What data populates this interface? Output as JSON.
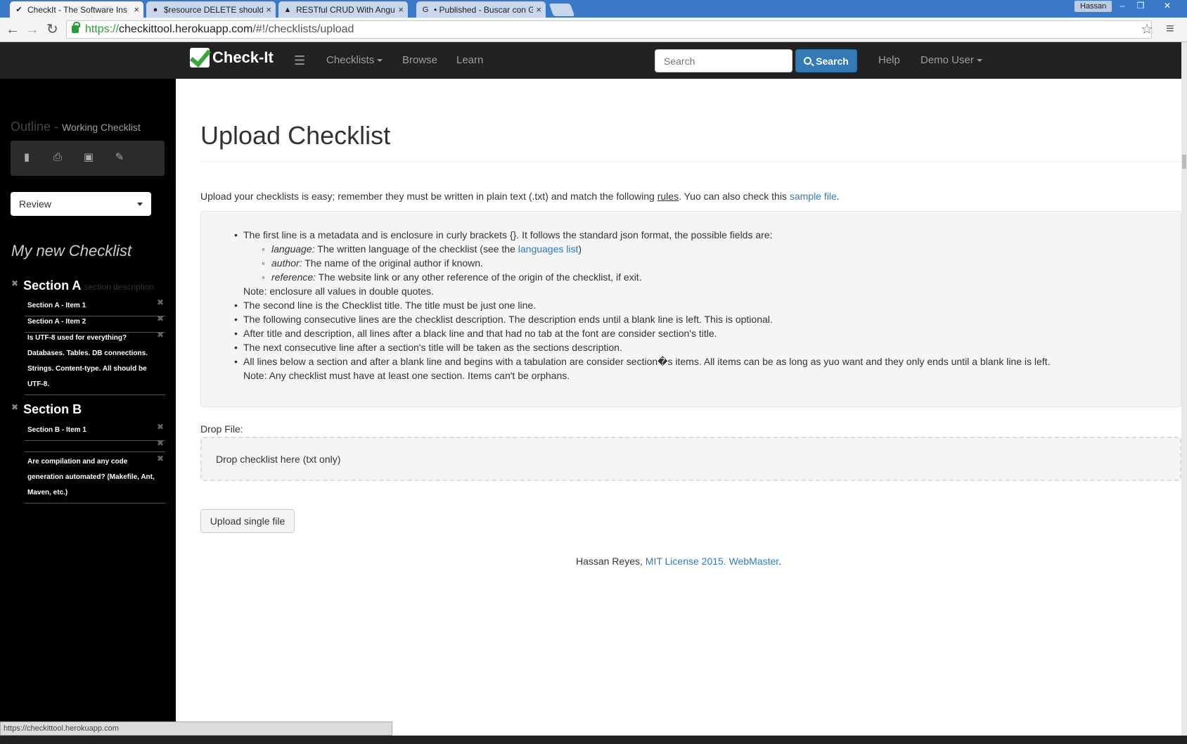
{
  "browser": {
    "tabs": [
      {
        "title": "CheckIt - The Software Ins",
        "active": true,
        "icon": "checkmark-icon"
      },
      {
        "title": "$resource DELETE should",
        "active": false,
        "icon": "github-icon"
      },
      {
        "title": "RESTful CRUD With Angul",
        "active": false,
        "icon": "article-icon"
      },
      {
        "title": "• Published - Buscar con G",
        "active": false,
        "icon": "google-icon"
      }
    ],
    "profile": "Hassan",
    "url_scheme": "https://",
    "url_host": "checkittool.herokuapp.com",
    "url_path": "/#!/checklists/upload",
    "status_url": "https://checkittool.herokuapp.com"
  },
  "navbar": {
    "brand": "Check-It",
    "links": {
      "checklists": "Checklists",
      "browse": "Browse",
      "learn": "Learn",
      "help": "Help",
      "user": "Demo User"
    },
    "search_placeholder": "Search",
    "search_button": "Search"
  },
  "sidebar": {
    "outline": "Outline -",
    "outline_sub": "Working Checklist",
    "review_select": "Review",
    "checklist_title": "My new Checklist",
    "sections": [
      {
        "title": "Section A",
        "description": "section description",
        "items": [
          "Section A - Item 1",
          "Section A - Item 2",
          "Is UTF-8 used for everything? Databases. Tables. DB connections. Strings. Content-type. All should be UTF-8."
        ]
      },
      {
        "title": "Section B",
        "description": "",
        "items": [
          "Section B - Item 1",
          "",
          "Are compilation and any code generation automated? (Makefile, Ant, Maven, etc.)"
        ]
      }
    ]
  },
  "main": {
    "title": "Upload Checklist",
    "intro_a": "Upload your checklists is easy; remember they must be written in plain text (.txt) and match the following ",
    "intro_rules": "rules",
    "intro_b": ". Yuo can also check this ",
    "intro_sample": "sample file",
    "intro_c": ".",
    "rules": {
      "r1": "The first line is a metadata and is enclosure in curly brackets {}. It follows the standard json format, the possible fields are:",
      "f1_name": "language:",
      "f1_text_a": " The written language of the checklist (see the ",
      "f1_link": "languages list",
      "f1_text_b": ")",
      "f2_name": "author:",
      "f2_text": " The name of the original author if known.",
      "f3_name": "reference:",
      "f3_text": " The website link or any other reference of the origin of the checklist, if exit.",
      "note1": "Note: enclosure all values in double quotes.",
      "r2": "The second line is the Checklist title. The title must be just one line.",
      "r3": "The following consecutive lines are the checklist description. The description ends until a blank line is left. This is optional.",
      "r4": "After title and description, all lines after a black line and that had no tab at the font are consider section's title.",
      "r5": "The next consecutive line after a section's title will be taken as the sections description.",
      "r6": "All lines below a section and after a blank line and begins with a tabulation are consider section�s items. All items can be as long as yuo want and they only ends until a blank line is left.",
      "note2": "Note: Any checklist must have at least one section. Items can't be orphans."
    },
    "drop_label": "Drop File:",
    "drop_text": "Drop checklist here (txt only)",
    "upload_button": "Upload single file",
    "footer_author": "Hassan Reyes, ",
    "footer_license": "MIT License 2015.",
    "footer_webmaster": "WebMaster",
    "footer_end": "."
  }
}
